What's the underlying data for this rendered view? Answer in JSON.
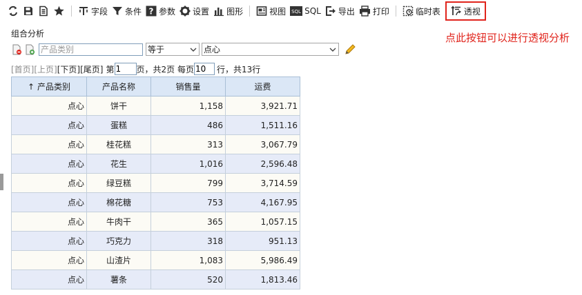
{
  "toolbar": {
    "field_label": "字段",
    "condition_label": "条件",
    "param_label": "参数",
    "settings_label": "设置",
    "chart_label": "图形",
    "view_label": "视图",
    "sql_label": "SQL",
    "export_label": "导出",
    "print_label": "打印",
    "temp_table_label": "临时表",
    "pivot_label": "透视"
  },
  "annotation": "点此按钮可以进行透视分析",
  "section_title": "组合分析",
  "filter": {
    "field_placeholder": "产品类别",
    "operator": "等于",
    "value": "点心"
  },
  "pager": {
    "first": "[首页]",
    "prev": "[上页]",
    "next": "[下页]",
    "last": "[尾页]",
    "page_prefix": "第",
    "current_page": "1",
    "page_suffix": "页，共2页 每页",
    "page_size": "10",
    "total": "行，共13行"
  },
  "table": {
    "sort_arrow": "↑",
    "headers": [
      "产品类别",
      "产品名称",
      "销售量",
      "运费"
    ],
    "rows": [
      [
        "点心",
        "饼干",
        "1,158",
        "3,921.71"
      ],
      [
        "点心",
        "蛋糕",
        "486",
        "1,511.16"
      ],
      [
        "点心",
        "桂花糕",
        "313",
        "3,067.79"
      ],
      [
        "点心",
        "花生",
        "1,016",
        "2,596.48"
      ],
      [
        "点心",
        "绿豆糕",
        "799",
        "3,714.59"
      ],
      [
        "点心",
        "棉花糖",
        "753",
        "4,167.95"
      ],
      [
        "点心",
        "牛肉干",
        "365",
        "1,057.15"
      ],
      [
        "点心",
        "巧克力",
        "318",
        "951.13"
      ],
      [
        "点心",
        "山渣片",
        "1,083",
        "5,986.49"
      ],
      [
        "点心",
        "薯条",
        "520",
        "1,813.46"
      ]
    ]
  },
  "colors": {
    "highlight": "#e0231b",
    "header_bg": "#dbe7f6",
    "row_odd": "#fcfbf5",
    "row_even": "#e6ebf8"
  }
}
